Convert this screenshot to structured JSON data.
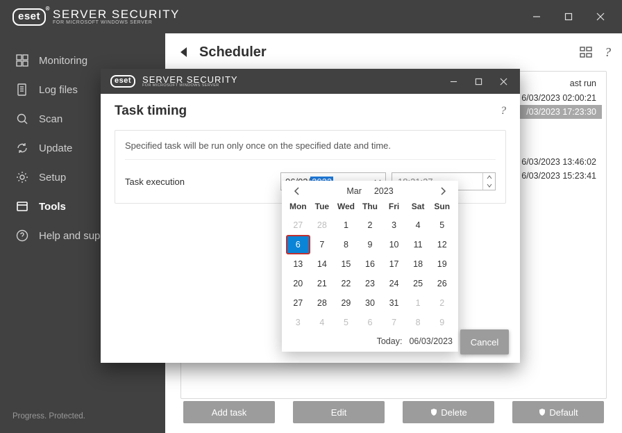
{
  "app": {
    "brand": "eset",
    "title_line1": "SERVER SECURITY",
    "title_line2": "FOR MICROSOFT WINDOWS SERVER"
  },
  "sidebar": {
    "items": [
      {
        "label": "Monitoring"
      },
      {
        "label": "Log files"
      },
      {
        "label": "Scan"
      },
      {
        "label": "Update"
      },
      {
        "label": "Setup"
      },
      {
        "label": "Tools"
      },
      {
        "label": "Help and support"
      }
    ],
    "footer": "Progress. Protected."
  },
  "scheduler": {
    "header": "Scheduler",
    "table": {
      "col_lastrun": "ast run",
      "rows": [
        {
          "lastrun": "6/03/2023 02:00:21",
          "selected": false
        },
        {
          "lastrun": "/03/2023 17:23:30",
          "selected": true
        },
        {
          "lastrun": "6/03/2023 13:46:02",
          "selected": false
        },
        {
          "lastrun": "6/03/2023 15:23:41",
          "selected": false
        }
      ]
    },
    "buttons": {
      "add": "Add task",
      "edit": "Edit",
      "delete": "Delete",
      "default": "Default"
    }
  },
  "dialog": {
    "title": "Task timing",
    "help": "?",
    "description": "Specified task will be run only once on the specified date and time.",
    "execution_label": "Task execution",
    "date_prefix": "06/03/",
    "date_year": "2023",
    "time_value": "18:31:27"
  },
  "datepicker": {
    "month": "Mar",
    "year": "2023",
    "dow": [
      "Mon",
      "Tue",
      "Wed",
      "Thu",
      "Fri",
      "Sat",
      "Sun"
    ],
    "weeks": [
      [
        {
          "n": "27",
          "out": true
        },
        {
          "n": "28",
          "out": true
        },
        {
          "n": "1"
        },
        {
          "n": "2"
        },
        {
          "n": "3"
        },
        {
          "n": "4"
        },
        {
          "n": "5"
        }
      ],
      [
        {
          "n": "6",
          "today": true
        },
        {
          "n": "7"
        },
        {
          "n": "8"
        },
        {
          "n": "9"
        },
        {
          "n": "10"
        },
        {
          "n": "11"
        },
        {
          "n": "12"
        }
      ],
      [
        {
          "n": "13"
        },
        {
          "n": "14"
        },
        {
          "n": "15"
        },
        {
          "n": "16"
        },
        {
          "n": "17"
        },
        {
          "n": "18"
        },
        {
          "n": "19"
        }
      ],
      [
        {
          "n": "20"
        },
        {
          "n": "21"
        },
        {
          "n": "22"
        },
        {
          "n": "23"
        },
        {
          "n": "24"
        },
        {
          "n": "25"
        },
        {
          "n": "26"
        }
      ],
      [
        {
          "n": "27"
        },
        {
          "n": "28"
        },
        {
          "n": "29"
        },
        {
          "n": "30"
        },
        {
          "n": "31"
        },
        {
          "n": "1",
          "out": true
        },
        {
          "n": "2",
          "out": true
        }
      ],
      [
        {
          "n": "3",
          "out": true
        },
        {
          "n": "4",
          "out": true
        },
        {
          "n": "5",
          "out": true
        },
        {
          "n": "6",
          "out": true
        },
        {
          "n": "7",
          "out": true
        },
        {
          "n": "8",
          "out": true
        },
        {
          "n": "9",
          "out": true
        }
      ]
    ],
    "footer_label": "Today:",
    "footer_date": "06/03/2023",
    "cancel": "Cancel"
  }
}
